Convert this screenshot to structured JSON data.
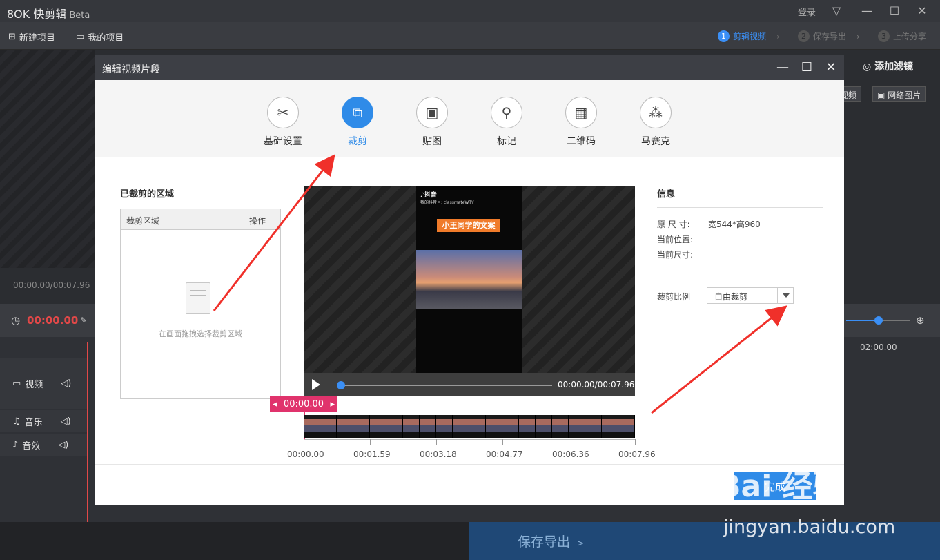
{
  "app": {
    "logo_text": "8OK 快剪辑",
    "beta": "Beta",
    "login": "登录"
  },
  "menubar": {
    "new_project": "新建项目",
    "my_projects": "我的项目"
  },
  "steps": [
    {
      "num": "1",
      "label": "剪辑视频"
    },
    {
      "num": "2",
      "label": "保存导出"
    },
    {
      "num": "3",
      "label": "上传分享"
    }
  ],
  "right_panel": {
    "add_filter": "添加滤镜",
    "local_video": "视频",
    "net_image": "网络图片"
  },
  "preview": {
    "timecode": "00:00.00/00:07.96"
  },
  "timeline": {
    "current_time": "00:00.00",
    "ruler_time": "02:00.00",
    "zoom": 0.5,
    "tracks": [
      {
        "name": "视频"
      },
      {
        "name": "音乐"
      },
      {
        "name": "音效"
      }
    ]
  },
  "save_export": "保存导出 ﹥",
  "dialog": {
    "title": "编辑视频片段",
    "tabs": [
      {
        "label": "基础设置",
        "icon": "✂"
      },
      {
        "label": "裁剪",
        "icon": "⧉"
      },
      {
        "label": "贴图",
        "icon": "▣"
      },
      {
        "label": "标记",
        "icon": "⚲"
      },
      {
        "label": "二维码",
        "icon": "▦"
      },
      {
        "label": "马赛克",
        "icon": "⁂"
      }
    ],
    "cropped_area_title": "已裁剪的区域",
    "table_headers": {
      "area": "裁剪区域",
      "action": "操作"
    },
    "empty_hint": "在画面拖拽选择裁剪区域",
    "video": {
      "platform": "抖音",
      "account": "我的抖音号: classmateWTY",
      "caption": "小王同学的文案"
    },
    "player_time": "00:00.00/00:07.96",
    "player_progress": 0.0,
    "marker_time": "00:00.00",
    "ruler_labels": [
      "00:00.00",
      "00:01.59",
      "00:03.18",
      "00:04.77",
      "00:06.36",
      "00:07.96"
    ],
    "info": {
      "title": "信息",
      "orig_size_label": "原 尺 寸:",
      "orig_size_value": "宽544*高960",
      "cur_pos_label": "当前位置:",
      "cur_size_label": "当前尺寸:"
    },
    "ratio_label": "裁剪比例",
    "ratio_value": "自由裁剪",
    "done": "完成"
  },
  "watermark": {
    "brand": "Bai 经验",
    "url": "jingyan.baidu.com"
  },
  "colors": {
    "accent": "#2f8be8",
    "marker": "#e0336c",
    "time_red": "#e14848",
    "arrow": "#f0302a"
  }
}
